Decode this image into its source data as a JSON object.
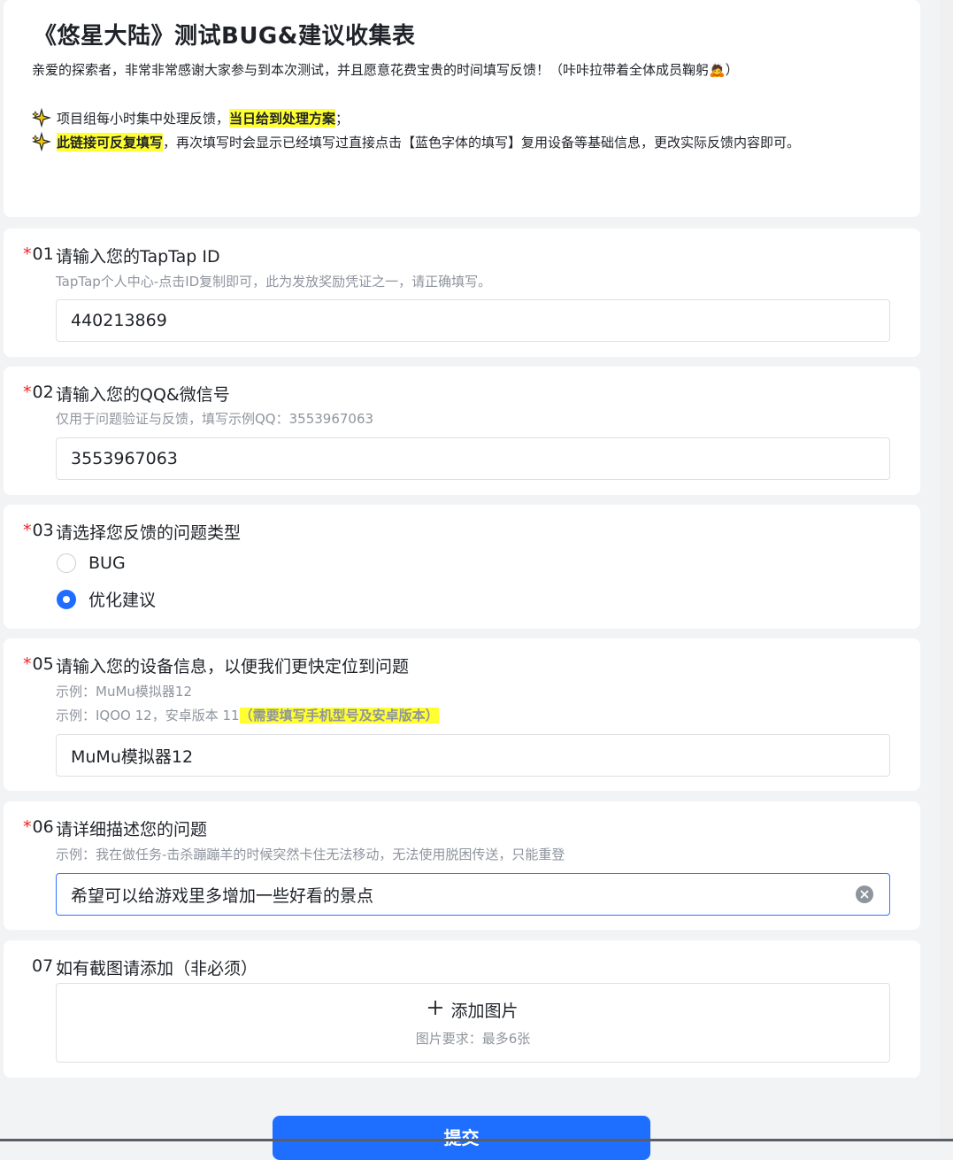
{
  "header": {
    "title": "《悠星大陆》测试BUG&建议收集表",
    "intro": "亲爱的探索者，非常非常感谢大家参与到本次测试，并且愿意花费宝贵的时间填写反馈！（咔咔拉带着全体成员鞠躬🙇）",
    "bullet1_pre": "项目组每小时集中处理反馈，",
    "bullet1_highlight": "当日给到处理方案",
    "bullet1_post": "；",
    "bullet2_highlight": "此链接可反复填写",
    "bullet2_post": "，再次填写时会显示已经填写过直接点击【蓝色字体的填写】复用设备等基础信息，更改实际反馈内容即可。"
  },
  "q1": {
    "star": "*",
    "num": "01",
    "title": "请输入您的TapTap ID",
    "desc": "TapTap个人中心-点击ID复制即可，此为发放奖励凭证之一，请正确填写。",
    "value": "440213869"
  },
  "q2": {
    "star": "*",
    "num": "02",
    "title": "请输入您的QQ&微信号",
    "desc": "仅用于问题验证与反馈，填写示例QQ：3553967063",
    "value": "3553967063"
  },
  "q3": {
    "star": "*",
    "num": "03",
    "title": "请选择您反馈的问题类型",
    "options": [
      {
        "label": "BUG",
        "checked": false
      },
      {
        "label": "优化建议",
        "checked": true
      }
    ]
  },
  "q5": {
    "star": "*",
    "num": "05",
    "title": "请输入您的设备信息，以便我们更快定位到问题",
    "desc1": "示例：MuMu模拟器12",
    "desc2_pre": "示例：IQOO 12，安卓版本 11",
    "desc2_highlight": "（需要填写手机型号及安卓版本）",
    "value": "MuMu模拟器12"
  },
  "q6": {
    "star": "*",
    "num": "06",
    "title": "请详细描述您的问题",
    "desc": "示例：我在做任务-击杀蹦蹦羊的时候突然卡住无法移动，无法使用脱困传送，只能重登",
    "value": "希望可以给游戏里多增加一些好看的景点"
  },
  "q7": {
    "num": "07",
    "title": "如有截图请添加（非必须）",
    "upload_label": "添加图片",
    "upload_hint": "图片要求：最多6张"
  },
  "submit_label": "提交",
  "colors": {
    "accent": "#1e6fff",
    "required": "#ee2222",
    "highlight": "#ffff32"
  }
}
